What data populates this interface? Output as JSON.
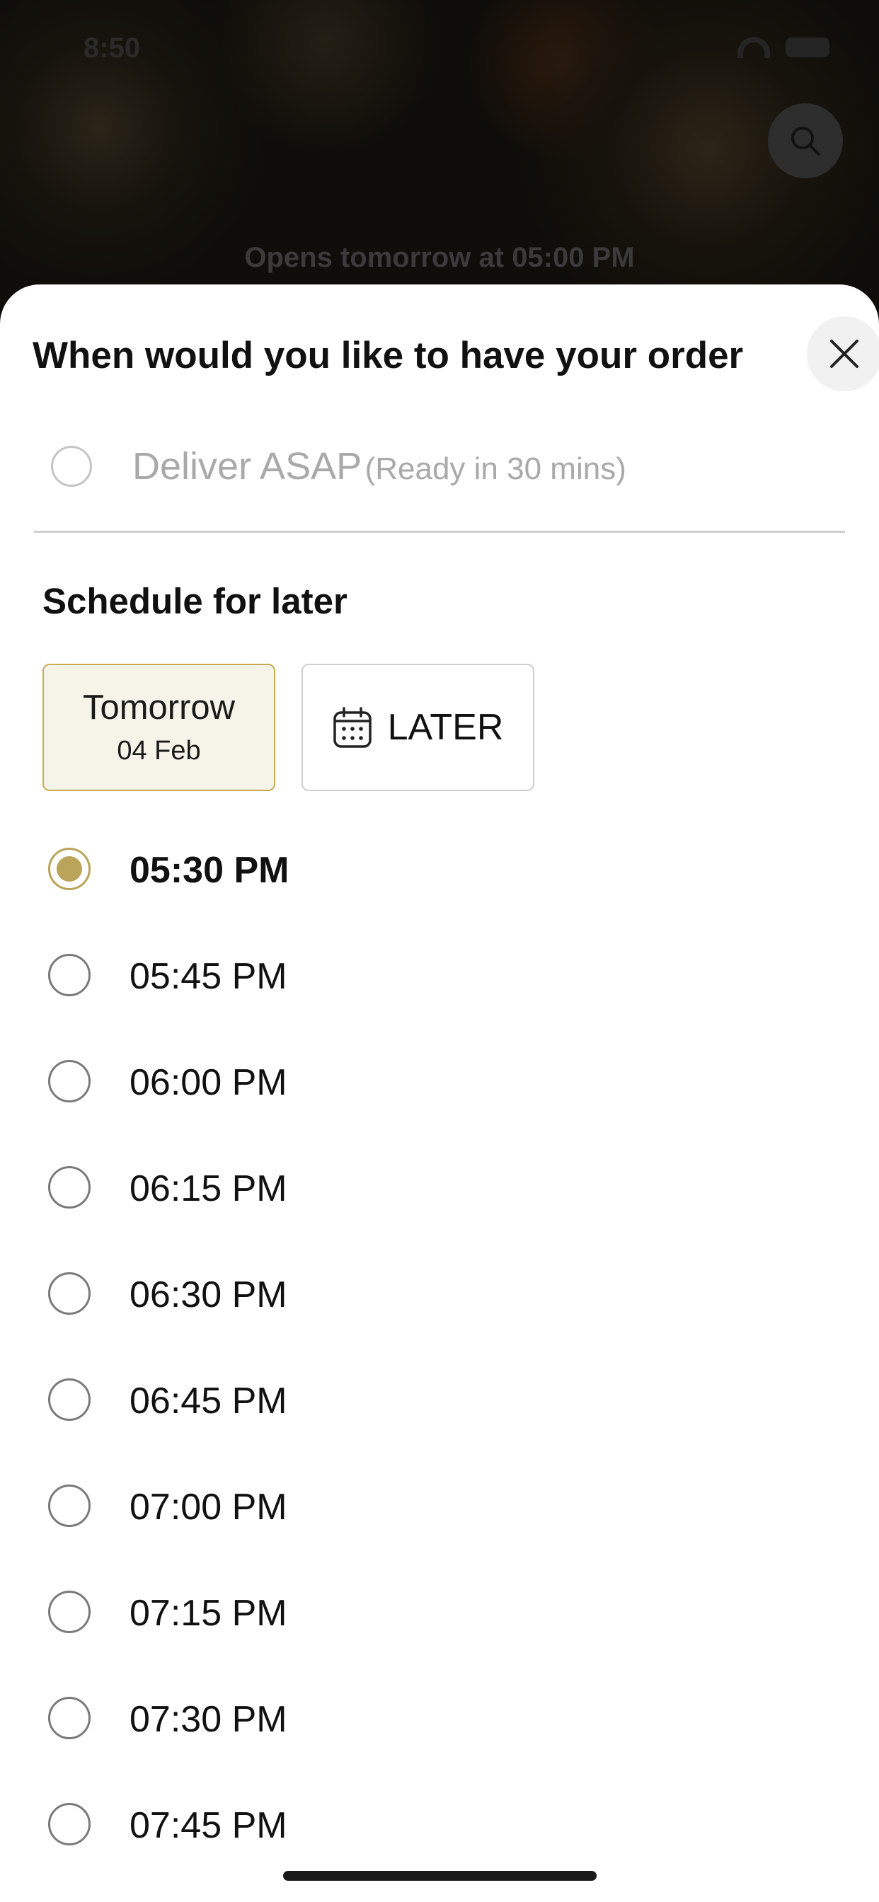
{
  "status_bar": {
    "time": "8:50"
  },
  "background": {
    "opens_text": "Opens tomorrow at 05:00 PM"
  },
  "sheet": {
    "title": "When would you like to have your order",
    "asap": {
      "label": "Deliver ASAP",
      "sub": "(Ready in 30 mins)",
      "selected": false
    },
    "schedule_title": "Schedule for later",
    "date_options": {
      "tomorrow_label": "Tomorrow",
      "tomorrow_date": "04 Feb",
      "later_label": "LATER"
    },
    "time_slots": [
      {
        "label": "05:30 PM",
        "selected": true
      },
      {
        "label": "05:45 PM",
        "selected": false
      },
      {
        "label": "06:00 PM",
        "selected": false
      },
      {
        "label": "06:15 PM",
        "selected": false
      },
      {
        "label": "06:30 PM",
        "selected": false
      },
      {
        "label": "06:45 PM",
        "selected": false
      },
      {
        "label": "07:00 PM",
        "selected": false
      },
      {
        "label": "07:15 PM",
        "selected": false
      },
      {
        "label": "07:30 PM",
        "selected": false
      },
      {
        "label": "07:45 PM",
        "selected": false
      }
    ]
  },
  "colors": {
    "accent": "#b9a45a",
    "selected_date_bg": "#f6f4e9",
    "text": "#111111",
    "muted": "#a9a9a9"
  }
}
